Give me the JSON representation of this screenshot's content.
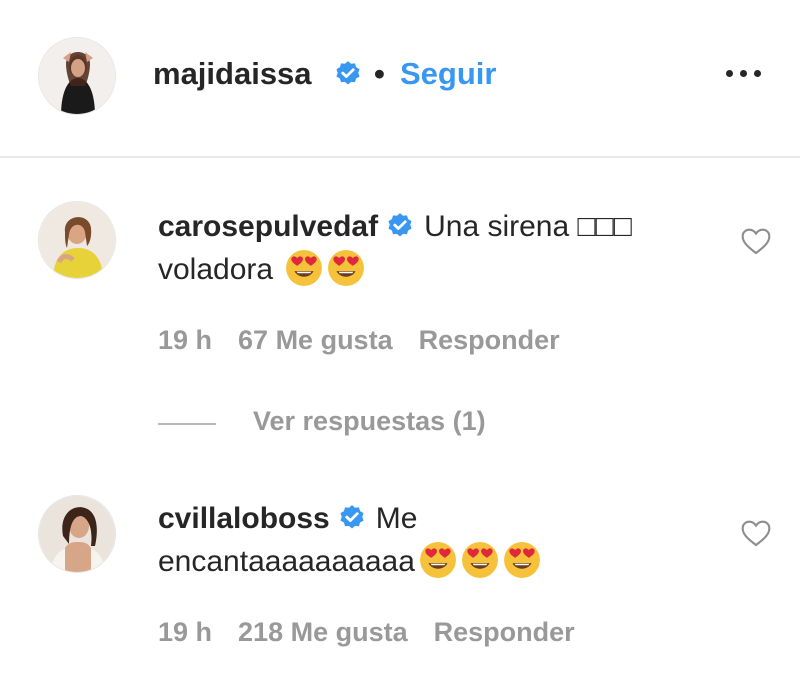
{
  "post_header": {
    "username": "majidaissa",
    "separator": "•",
    "follow_label": "Seguir"
  },
  "comments": [
    {
      "username": "carosepulvedaf",
      "text_line1": "Una sirena □□□",
      "text_line2": "voladora",
      "emoji_count": 2,
      "time": "19 h",
      "likes": "67 Me gusta",
      "reply_label": "Responder",
      "view_replies": "Ver respuestas (1)"
    },
    {
      "username": "cvillaloboss",
      "text_line1": "Me",
      "text_line2": "encantaaaaaaaaaa",
      "emoji_count": 3,
      "time": "19 h",
      "likes": "218 Me gusta",
      "reply_label": "Responder"
    }
  ],
  "icons": {
    "verified": "verified-badge-icon",
    "more": "more-options-icon",
    "like": "heart-outline-icon",
    "emoji": "heart-eyes-emoji-icon"
  },
  "colors": {
    "link": "#3897f0",
    "verified": "#3897f0",
    "meta_text": "#999999",
    "primary_text": "#262626",
    "divider": "#e8e8e8"
  }
}
